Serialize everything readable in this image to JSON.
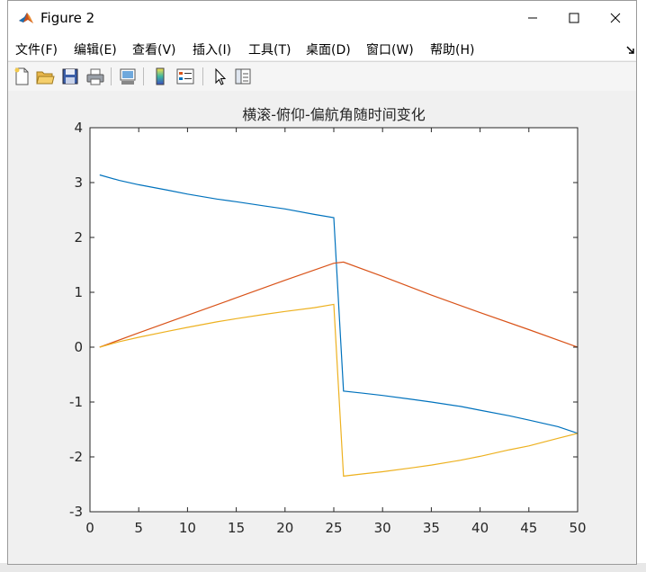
{
  "window": {
    "title": "Figure 2"
  },
  "menu": {
    "items": [
      "文件(F)",
      "编辑(E)",
      "查看(V)",
      "插入(I)",
      "工具(T)",
      "桌面(D)",
      "窗口(W)",
      "帮助(H)"
    ]
  },
  "toolbar": {
    "icons": [
      "new-figure-icon",
      "open-file-icon",
      "save-icon",
      "print-icon",
      "link-plot-icon",
      "colorbar-icon",
      "legend-icon",
      "pointer-icon",
      "property-editor-icon"
    ]
  },
  "colors": {
    "series1": "#0072BD",
    "series2": "#D95319",
    "series3": "#EDB120",
    "axes_bg": "#ffffff",
    "figure_bg": "#f0f0f0"
  },
  "chart_data": {
    "type": "line",
    "title": "横滚-俯仰-偏航角随时间变化",
    "xlabel": "",
    "ylabel": "",
    "xlim": [
      0,
      50
    ],
    "ylim": [
      -3,
      4
    ],
    "xticks": [
      0,
      5,
      10,
      15,
      20,
      25,
      30,
      35,
      40,
      45,
      50
    ],
    "yticks": [
      -3,
      -2,
      -1,
      0,
      1,
      2,
      3,
      4
    ],
    "grid": false,
    "legend": "none",
    "series": [
      {
        "color": "#0072BD",
        "x": [
          1,
          3,
          5,
          8,
          10,
          13,
          15,
          18,
          20,
          23,
          25,
          26,
          28,
          30,
          33,
          35,
          38,
          40,
          43,
          45,
          48,
          50
        ],
        "y": [
          3.14,
          3.04,
          2.96,
          2.86,
          2.79,
          2.7,
          2.65,
          2.57,
          2.52,
          2.42,
          2.36,
          -0.8,
          -0.84,
          -0.88,
          -0.95,
          -1.0,
          -1.08,
          -1.15,
          -1.25,
          -1.33,
          -1.45,
          -1.57
        ]
      },
      {
        "color": "#D95319",
        "x": [
          1,
          5,
          10,
          15,
          20,
          25,
          26,
          30,
          35,
          40,
          45,
          50
        ],
        "y": [
          0.0,
          0.26,
          0.58,
          0.9,
          1.22,
          1.53,
          1.55,
          1.29,
          0.95,
          0.63,
          0.32,
          0.0
        ]
      },
      {
        "color": "#EDB120",
        "x": [
          1,
          3,
          5,
          8,
          10,
          13,
          15,
          18,
          20,
          23,
          25,
          26,
          28,
          30,
          33,
          35,
          38,
          40,
          43,
          45,
          48,
          50
        ],
        "y": [
          0.0,
          0.1,
          0.18,
          0.29,
          0.36,
          0.46,
          0.52,
          0.6,
          0.65,
          0.72,
          0.78,
          -2.35,
          -2.31,
          -2.27,
          -2.2,
          -2.15,
          -2.06,
          -1.99,
          -1.87,
          -1.8,
          -1.66,
          -1.57
        ]
      }
    ]
  }
}
